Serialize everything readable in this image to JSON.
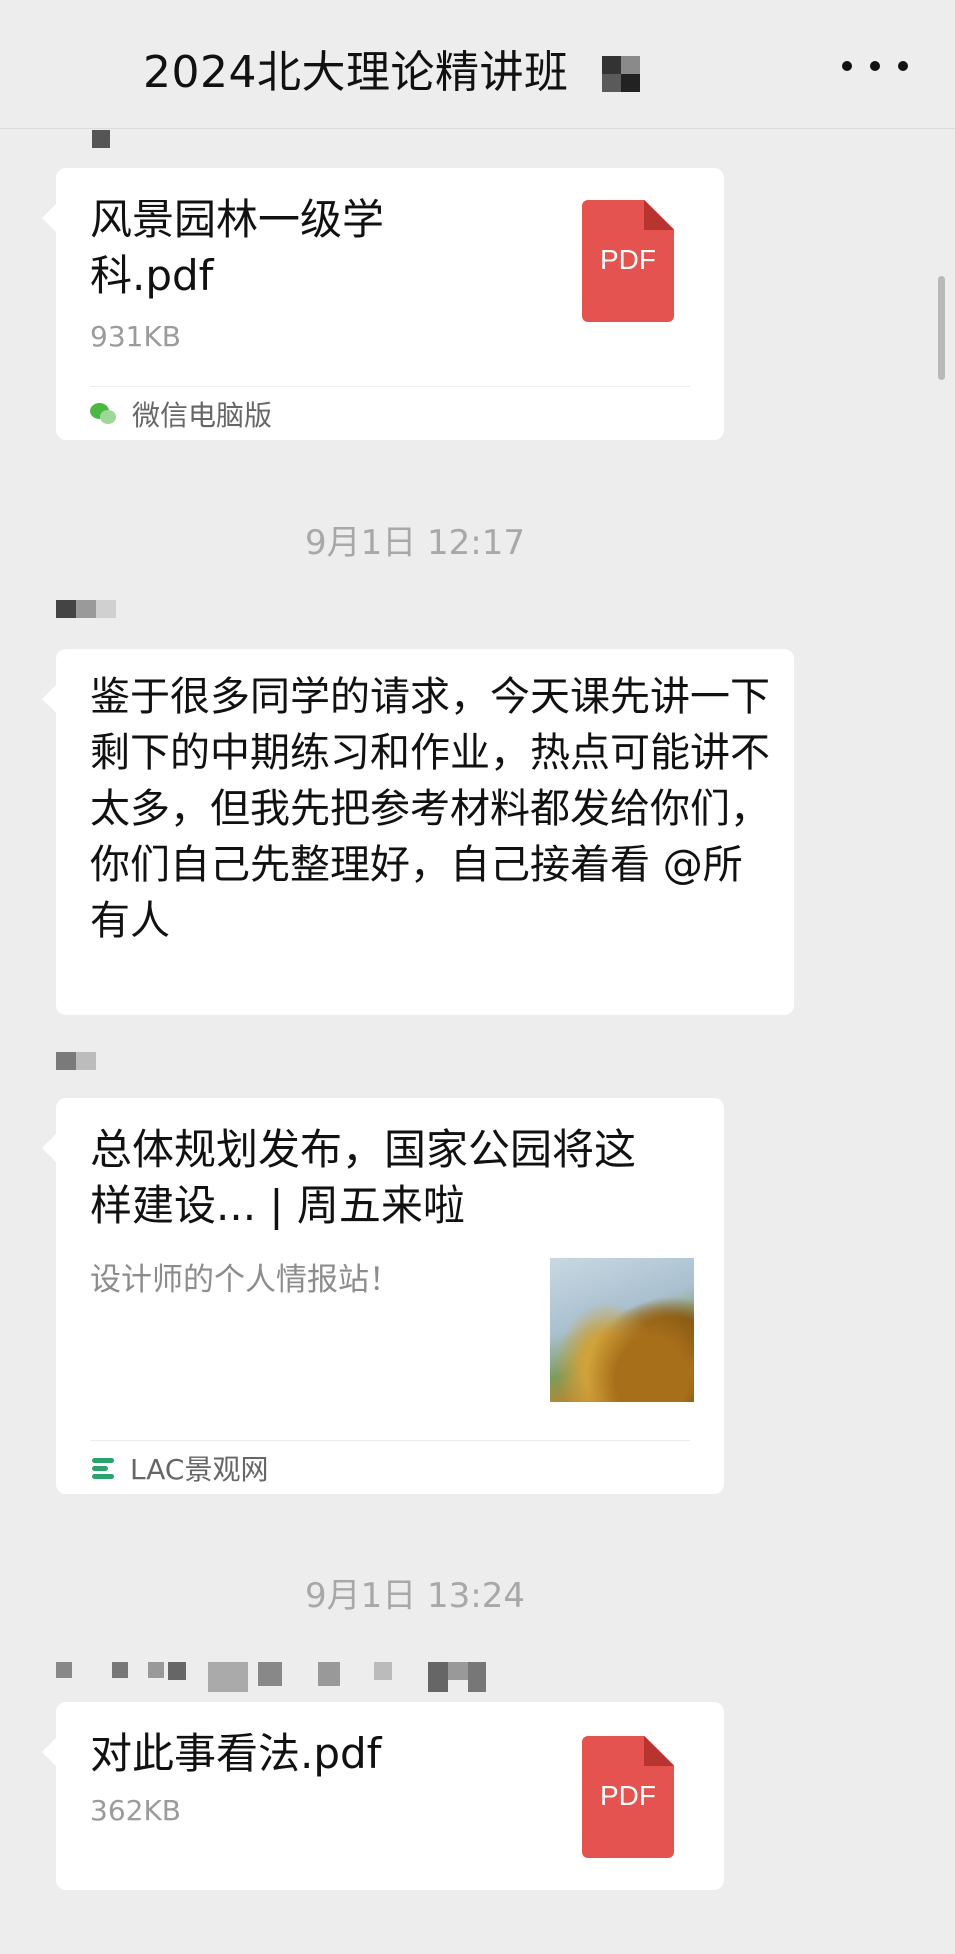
{
  "header": {
    "title": "2024北大理论精讲班",
    "more_icon": "more-icon"
  },
  "messages": [
    {
      "type": "file",
      "file_name": "风景园林一级学科.pdf",
      "file_size": "931KB",
      "file_type_label": "PDF",
      "source_label": "微信电脑版",
      "source_icon": "wechat-icon"
    },
    {
      "type": "time",
      "text": "9月1日 12:17"
    },
    {
      "type": "text",
      "text": "鉴于很多同学的请求，今天课先讲一下剩下的中期练习和作业，热点可能讲不太多，但我先把参考材料都发给你们，你们自己先整理好，自己接着看 @所有人"
    },
    {
      "type": "link",
      "title": "总体规划发布，国家公园将这样建设... | 周五来啦",
      "description": "设计师的个人情报站！",
      "source_label": "LAC景观网",
      "source_icon": "lac-icon"
    },
    {
      "type": "time",
      "text": "9月1日 13:24"
    },
    {
      "type": "file",
      "file_name": "对此事看法.pdf",
      "file_size": "362KB",
      "file_type_label": "PDF"
    }
  ],
  "colors": {
    "background": "#ededed",
    "bubble": "#ffffff",
    "pdf_red": "#e4534f",
    "timestamp": "#a8a8a8",
    "secondary_text": "#9b9b9b"
  }
}
